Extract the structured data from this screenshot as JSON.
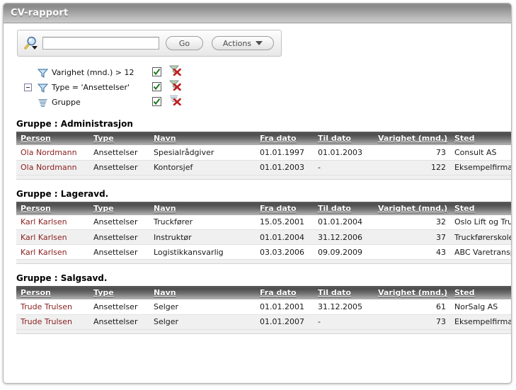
{
  "window": {
    "title": "CV-rapport"
  },
  "search": {
    "magnifier_icon": "search-icon",
    "input_value": "",
    "placeholder": "",
    "go_label": "Go",
    "actions_label": "Actions",
    "actions_caret_icon": "chevron-down-icon"
  },
  "criteria": {
    "expander_icon": "minus-box-icon",
    "rows": [
      {
        "icon": "funnel-filter-icon",
        "label": "Varighet (mnd.) > 12",
        "enabled": true,
        "check_icon": "checkmark-icon",
        "remove_icon": "remove-filter-icon",
        "has_expander": false
      },
      {
        "icon": "funnel-filter-icon",
        "label": "Type = 'Ansettelser'",
        "enabled": true,
        "check_icon": "checkmark-icon",
        "remove_icon": "remove-filter-icon",
        "has_expander": true
      },
      {
        "icon": "group-by-icon",
        "label": "Gruppe",
        "enabled": true,
        "check_icon": "checkmark-icon",
        "remove_icon": "remove-group-icon",
        "has_expander": false
      }
    ]
  },
  "table": {
    "columns": [
      {
        "key": "person",
        "label": "Person",
        "align": "left"
      },
      {
        "key": "type",
        "label": "Type",
        "align": "left"
      },
      {
        "key": "navn",
        "label": "Navn",
        "align": "left"
      },
      {
        "key": "fra_dato",
        "label": "Fra dato",
        "align": "left"
      },
      {
        "key": "til_dato",
        "label": "Til dato",
        "align": "left"
      },
      {
        "key": "varighet",
        "label": "Varighet (mnd.)",
        "align": "right"
      },
      {
        "key": "sted",
        "label": "Sted",
        "align": "left"
      }
    ]
  },
  "groups": [
    {
      "label": "Gruppe : Administrasjon",
      "rows": [
        {
          "person": "Ola Nordmann",
          "type": "Ansettelser",
          "navn": "Spesialrådgiver",
          "fra_dato": "01.01.1997",
          "til_dato": "01.01.2003",
          "varighet": "73",
          "sted": "Consult AS"
        },
        {
          "person": "Ola Nordmann",
          "type": "Ansettelser",
          "navn": "Kontorsjef",
          "fra_dato": "01.01.2003",
          "til_dato": "-",
          "varighet": "122",
          "sted": "Eksempelfirma AS"
        }
      ]
    },
    {
      "label": "Gruppe : Lageravd.",
      "rows": [
        {
          "person": "Karl Karlsen",
          "type": "Ansettelser",
          "navn": "Truckfører",
          "fra_dato": "15.05.2001",
          "til_dato": "01.01.2004",
          "varighet": "32",
          "sted": "Oslo Lift og Truck AS"
        },
        {
          "person": "Karl Karlsen",
          "type": "Ansettelser",
          "navn": "Instruktør",
          "fra_dato": "01.01.2004",
          "til_dato": "31.12.2006",
          "varighet": "37",
          "sted": "Truckførerskolen AS"
        },
        {
          "person": "Karl Karlsen",
          "type": "Ansettelser",
          "navn": "Logistikkansvarlig",
          "fra_dato": "03.03.2006",
          "til_dato": "09.09.2009",
          "varighet": "43",
          "sted": "ABC Varetransport AS"
        }
      ]
    },
    {
      "label": "Gruppe : Salgsavd.",
      "rows": [
        {
          "person": "Trude Trulsen",
          "type": "Ansettelser",
          "navn": "Selger",
          "fra_dato": "01.01.2001",
          "til_dato": "31.12.2005",
          "varighet": "61",
          "sted": "NorSalg AS"
        },
        {
          "person": "Trude Trulsen",
          "type": "Ansettelser",
          "navn": "Selger",
          "fra_dato": "01.01.2007",
          "til_dato": "-",
          "varighet": "73",
          "sted": "Eksempelfirma AS"
        }
      ]
    }
  ],
  "colors": {
    "titlebar_text": "#ffffff",
    "person_link": "#8a1f1f",
    "header_bg_dark": "#4e4e4e",
    "row_alt_bg": "#f0f0f0",
    "check_green": "#1f7a1f",
    "delete_red": "#c02020",
    "funnel_blue": "#6ea8dc"
  }
}
